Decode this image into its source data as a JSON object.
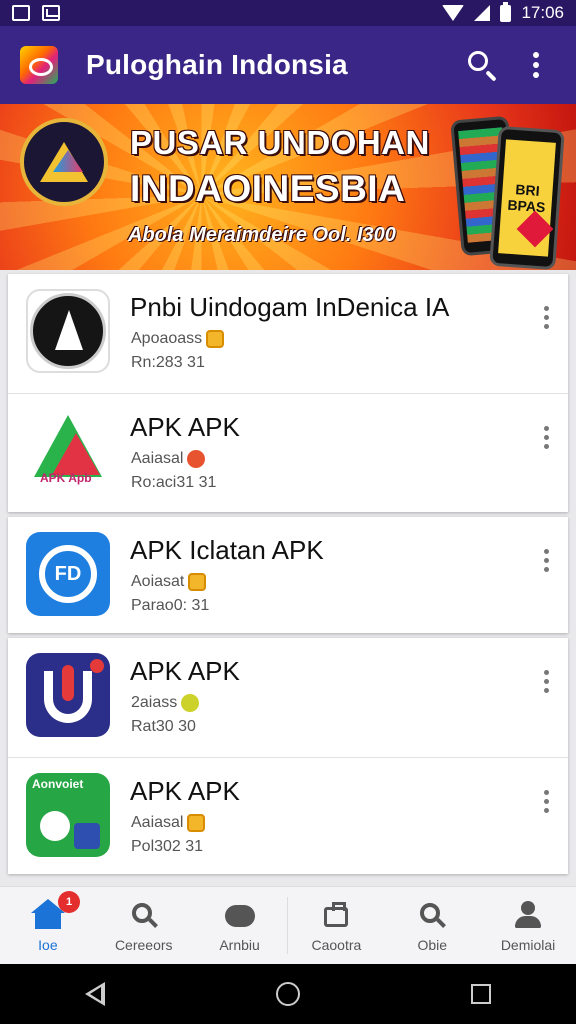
{
  "status_bar": {
    "time": "17:06"
  },
  "app_bar": {
    "title": "Puloghain Indonsia"
  },
  "banner": {
    "headline_1": "PUSAR UNDOHAN",
    "headline_2": "INDAOINESBIA",
    "subline": "Abola Meraimdeire Ool. I300",
    "phone_text": "BRI\nBPAS"
  },
  "apps": [
    {
      "name": "Pnbi Uindogam InDenica IA",
      "meta": "Apoaoass",
      "price": "Rn:283 31",
      "badge": "gift",
      "icon": "sword-emblem-icon"
    },
    {
      "name": "APK APK",
      "meta": "Aaiasal",
      "price": "Ro:aci31 31",
      "badge": "red",
      "icon": "apk-triangle-icon",
      "icon_text": "APK Apb"
    },
    {
      "name": "APK Iclatan APK",
      "meta": "Aoiasat",
      "price": "Parao0: 31",
      "badge": "gift",
      "icon": "fd-circle-icon",
      "icon_text": "FD"
    },
    {
      "name": "APK APK",
      "meta": "2aiass",
      "price": "Rat30 30",
      "badge": "yellow",
      "icon": "red-drop-icon"
    },
    {
      "name": "APK APK",
      "meta": "Aaiasal",
      "price": "Pol302 31",
      "badge": "gift",
      "icon": "green-pad-icon",
      "icon_text": "Aonvoiet"
    }
  ],
  "bottom_nav": [
    {
      "label": "Ioe",
      "icon": "home-icon",
      "active": true,
      "badge": "1"
    },
    {
      "label": "Cereeors",
      "icon": "search-icon",
      "active": false
    },
    {
      "label": "Arnbiu",
      "icon": "gamepad-icon",
      "active": false
    },
    {
      "label": "Caootra",
      "icon": "bag-icon",
      "active": false
    },
    {
      "label": "Obie",
      "icon": "search-icon",
      "active": false
    },
    {
      "label": "Demiolai",
      "icon": "user-icon",
      "active": false
    }
  ],
  "colors": {
    "app_bar": "#3a2687",
    "status_bar": "#2a1763",
    "accent": "#1b73d8"
  }
}
